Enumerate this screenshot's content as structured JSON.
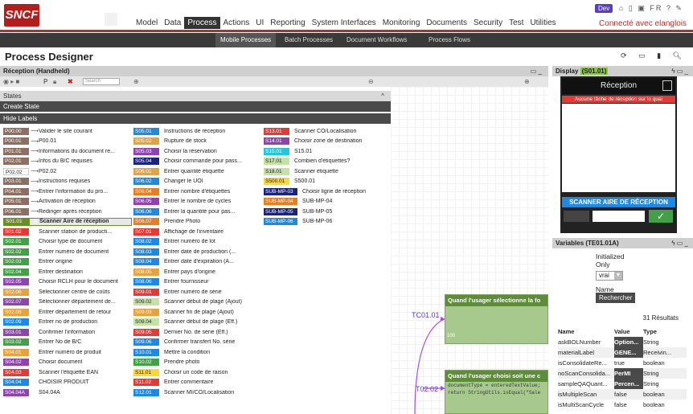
{
  "brand": {
    "logo": "SNCF",
    "env_badge": "Dev",
    "lang": "FR"
  },
  "main_nav": [
    "Model",
    "Data",
    "Process",
    "Actions",
    "UI",
    "Reporting",
    "System Interfaces",
    "Monitoring",
    "Documents",
    "Security",
    "Test",
    "Utilities"
  ],
  "main_nav_active": "Process",
  "connect_link": "Connecté avec elanglois",
  "sub_nav": [
    "Mobile Processes",
    "Batch Processes",
    "Document Workflows",
    "Process Flows"
  ],
  "sub_nav_active": "Mobile Processes",
  "page_title": "Process Designer",
  "left_panel": {
    "title": "Réception (Handheld)",
    "search_placeholder": "Search",
    "states_label": "States",
    "create_state": "Create State",
    "hide_labels": "Hide Labels",
    "col1": [
      {
        "code": "P00.00",
        "color": "#8d6e63",
        "label": "Valider le site courant"
      },
      {
        "code": "P00.01",
        "color": "#8d6e63",
        "label": "P00.01"
      },
      {
        "code": "P01.01",
        "color": "#8d6e63",
        "label": "Informations du document re..."
      },
      {
        "code": "P02.01",
        "color": "#8d6e63",
        "label": "Infos du B/C requises"
      },
      {
        "code": "P02.02",
        "color": "#ffffff",
        "label": "P02.02"
      },
      {
        "code": "P03.01",
        "color": "#8d6e63",
        "label": "Instructions requises"
      },
      {
        "code": "P04.01",
        "color": "#8d6e63",
        "label": "Entrer l'information du pro..."
      },
      {
        "code": "P05.01",
        "color": "#8d6e63",
        "label": "Activation de réception"
      },
      {
        "code": "P06.01",
        "color": "#8d6e63",
        "label": "Rediriger après réception"
      },
      {
        "code": "S01.01",
        "color": "#6b8e23",
        "label": "Scanner Aire de réception"
      },
      {
        "code": "S01.02",
        "color": "#e53935",
        "label": "Scanner station de producti..."
      },
      {
        "code": "S02.01",
        "color": "#43a047",
        "label": "Choisir type de document"
      },
      {
        "code": "S02.02",
        "color": "#43a047",
        "label": "Entrer numéro de document"
      },
      {
        "code": "S02.03",
        "color": "#43a047",
        "label": "Entrer origine"
      },
      {
        "code": "S02.04",
        "color": "#43a047",
        "label": "Entrer destination"
      },
      {
        "code": "S02.05",
        "color": "#8e44ad",
        "label": "Choisir RCLH pour le document"
      },
      {
        "code": "S02.06",
        "color": "#e6a23c",
        "label": "Sélectionner centre de coûts"
      },
      {
        "code": "S02.07",
        "color": "#8e44ad",
        "label": "Sélectionner département de..."
      },
      {
        "code": "S02.08",
        "color": "#e6a23c",
        "label": "Entrer département de retour"
      },
      {
        "code": "S02.09",
        "color": "#1e88e5",
        "label": "Entrer no de production"
      },
      {
        "code": "S03.01",
        "color": "#8e44ad",
        "label": "Confirmer l'information"
      },
      {
        "code": "S03.02",
        "color": "#43a047",
        "label": "Entrer No de B/C"
      },
      {
        "code": "S04.01",
        "color": "#e6a23c",
        "label": "Entrer numéro de produit"
      },
      {
        "code": "S04.02",
        "color": "#8e44ad",
        "label": "Choisir document"
      },
      {
        "code": "S04.03",
        "color": "#e53935",
        "label": "Scanner l'étiquette EAN"
      },
      {
        "code": "S04.04",
        "color": "#1e88e5",
        "label": "CHOISIR PRODUIT"
      },
      {
        "code": "S04.04A",
        "color": "#8e44ad",
        "label": "S04.04A"
      }
    ],
    "col2": [
      {
        "code": "S05.01",
        "color": "#1e88e5",
        "label": "Instructions de réception"
      },
      {
        "code": "S05.02",
        "color": "#e6a23c",
        "label": "Rupture de stock"
      },
      {
        "code": "S05.03",
        "color": "#8e44ad",
        "label": "Choisir la réservation"
      },
      {
        "code": "S05.04",
        "color": "#1a237e",
        "label": "Choisir commande pour pass..."
      },
      {
        "code": "S06.01",
        "color": "#e6a23c",
        "label": "Entrer quantité étiquette"
      },
      {
        "code": "S06.02",
        "color": "#1e88e5",
        "label": "Changer le UOI"
      },
      {
        "code": "S06.04",
        "color": "#e67e22",
        "label": "Entrer nombre d'étiquettes"
      },
      {
        "code": "S06.05",
        "color": "#8e44ad",
        "label": "Entrer le nombre de cycles"
      },
      {
        "code": "S06.06",
        "color": "#1e88e5",
        "label": "Entrer la quantité pour pas..."
      },
      {
        "code": "S06.07",
        "color": "#e67e22",
        "label": "Prendre Photo"
      },
      {
        "code": "S07.01",
        "color": "#e53935",
        "label": "Affichage de l'inventaire"
      },
      {
        "code": "S08.02",
        "color": "#1e88e5",
        "label": "Entrer numéro de lot"
      },
      {
        "code": "S08.03",
        "color": "#1e88e5",
        "label": "Entrer date de production (..."
      },
      {
        "code": "S08.04",
        "color": "#1e88e5",
        "label": "Entrer date d'expiration (A..."
      },
      {
        "code": "S08.05",
        "color": "#e6a23c",
        "label": "Entrer pays d'origine"
      },
      {
        "code": "S08.06",
        "color": "#1e88e5",
        "label": "Entrer fournisseur"
      },
      {
        "code": "S09.01",
        "color": "#e53935",
        "label": "Entrer numéro de série"
      },
      {
        "code": "S09.02",
        "color": "#c5e1a5",
        "label": "Scanner début de plage (Ajout)"
      },
      {
        "code": "S09.03",
        "color": "#e6a23c",
        "label": "Scanner fin de plage (Ajout)"
      },
      {
        "code": "S09.04",
        "color": "#c5e1a5",
        "label": "Scanner début de plage (Eff.)"
      },
      {
        "code": "S09.05",
        "color": "#e53935",
        "label": "Dernier No. de série (Eff.)"
      },
      {
        "code": "S09.06",
        "color": "#1e88e5",
        "label": "Confirmer transfert No. série"
      },
      {
        "code": "S10.01",
        "color": "#1e88e5",
        "label": "Mettre la condition"
      },
      {
        "code": "S10.02",
        "color": "#43a047",
        "label": "Prendre photo"
      },
      {
        "code": "S11.01",
        "color": "#fdd835",
        "label": "Choisir un code de raison"
      },
      {
        "code": "S11.02",
        "color": "#e53935",
        "label": "Entrer commentaire"
      },
      {
        "code": "S12.01",
        "color": "#1e88e5",
        "label": "Scanner MI/CO/Localisation"
      }
    ],
    "col3": [
      {
        "code": "S13.01",
        "color": "#e53935",
        "label": "Scanner CO/Localisation"
      },
      {
        "code": "S14.01",
        "color": "#8e44ad",
        "label": "Choisir zone de destination"
      },
      {
        "code": "S15.01",
        "color": "#26c6da",
        "label": "S15.01"
      },
      {
        "code": "S17.01",
        "color": "#c5e1a5",
        "label": "Combien d'étiquettes?"
      },
      {
        "code": "S18.01",
        "color": "#c5e1a5",
        "label": "Scanner étiquette"
      },
      {
        "code": "S500.01",
        "color": "#fdd835",
        "label": "S500.01"
      },
      {
        "code": "SUB-MP-03",
        "color": "#1a237e",
        "label": "Choisir ligne de réception"
      },
      {
        "code": "SUB-MP-04",
        "color": "#e67e22",
        "label": "SUB-MP-04"
      },
      {
        "code": "SUB-MP-05",
        "color": "#1a237e",
        "label": "SUB-MP-05"
      },
      {
        "code": "SUB-MP-06",
        "color": "#1e88e5",
        "label": "SUB-MP-06"
      }
    ]
  },
  "flow": {
    "tc1": "TC01.01",
    "tc2": "T02.02",
    "box1_title": "Quand l'usager sélectionne la fo",
    "box1_num": "100",
    "box2_title": "Quand l'usager choisi soit une c",
    "box2_code1": "documentType = enteredTextValue;",
    "box2_code2": "return StringUtils.isEqual(\"Sale"
  },
  "display_panel": {
    "title": "Display",
    "code": "(S01.01)",
    "phone_title": "Réception",
    "phone_msg": "Aucune tâche de réception sur le quai",
    "phone_button": "SCANNER AIRE DE RÉCEPTION"
  },
  "variables_panel": {
    "title": "Variables (TE01.01A)",
    "initialized_only": "Initialized Only",
    "select_value": "vrai",
    "name_label": "Name",
    "search_button": "Rechercher",
    "results": "31 Résultats",
    "headers": [
      "Name",
      "Value",
      "Type"
    ],
    "rows": [
      {
        "name": "askBOLNumber",
        "value": "Option...",
        "type": "String",
        "dark": true
      },
      {
        "name": "materialLabel",
        "value": "GENE...",
        "type": "Receivin...",
        "dark": true
      },
      {
        "name": "isConsolidateRe...",
        "value": "true",
        "type": "boolean",
        "dark": false
      },
      {
        "name": "noScanConsolida...",
        "value": "PerMI",
        "type": "String",
        "dark": true
      },
      {
        "name": "sampleQAQuant...",
        "value": "Percen...",
        "type": "String",
        "dark": true
      },
      {
        "name": "isMultipleScan",
        "value": "false",
        "type": "boolean",
        "dark": false
      },
      {
        "name": "isMultiScanCycle",
        "value": "false",
        "type": "boolean",
        "dark": false
      }
    ]
  }
}
